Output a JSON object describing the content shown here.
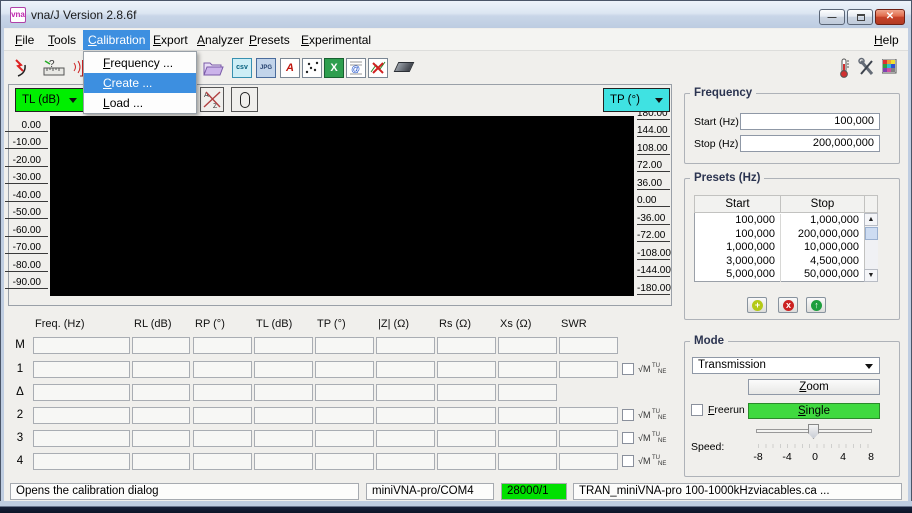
{
  "window": {
    "title": "vna/J Version 2.8.6f",
    "icon": "vna"
  },
  "menu": {
    "items": [
      "File",
      "Tools",
      "Calibration",
      "Export",
      "Analyzer",
      "Presets",
      "Experimental"
    ],
    "help": "Help",
    "active_item": "Calibration",
    "popup": {
      "items": [
        "Frequency ...",
        "Create ...",
        "Load ..."
      ],
      "active": "Create ..."
    }
  },
  "toolbar": {
    "icons": [
      "reconnect-icon",
      "ruler-question-icon",
      "antenna-icon",
      "folder-open-icon",
      "csv-export-icon",
      "jpeg-export-icon",
      "pdf-export-icon",
      "scatter-export-icon",
      "excel-export-icon",
      "report-icon",
      "chart-discard-icon",
      "eraser-icon",
      "temperature-icon",
      "settings-tools-icon",
      "color-palette-icon"
    ],
    "csv_label": "csv",
    "jpg_label": "JPG",
    "excel_label": "X",
    "pdf_label": "A"
  },
  "scale_left": {
    "selected": "TL (dB)",
    "color": "#00ef00",
    "labels": [
      "0.00",
      "-10.00",
      "-20.00",
      "-30.00",
      "-40.00",
      "-50.00",
      "-60.00",
      "-70.00",
      "-80.00",
      "-90.00"
    ]
  },
  "scale_right": {
    "selected": "TP (°)",
    "color": "#3fe2e2",
    "labels": [
      "180.00",
      "144.00",
      "108.00",
      "72.00",
      "36.00",
      "0.00",
      "-36.00",
      "-72.00",
      "-108.00",
      "-144.00",
      "-180.00"
    ]
  },
  "frequency": {
    "title": "Frequency",
    "start_label": "Start (Hz)",
    "start_value": "100,000",
    "stop_label": "Stop (Hz)",
    "stop_value": "200,000,000"
  },
  "presets": {
    "title": "Presets (Hz)",
    "columns": [
      "Start",
      "Stop"
    ],
    "rows": [
      [
        "100,000",
        "1,000,000"
      ],
      [
        "100,000",
        "200,000,000"
      ],
      [
        "1,000,000",
        "10,000,000"
      ],
      [
        "3,000,000",
        "4,500,000"
      ],
      [
        "5,000,000",
        "50,000,000"
      ]
    ],
    "add_glyph": "+",
    "delete_glyph": "x",
    "up_glyph": "↑"
  },
  "mode": {
    "title": "Mode",
    "selected": "Transmission",
    "zoom_label": "Zoom",
    "freerun_label": "Freerun",
    "single_label": "Single",
    "speed_label": "Speed:",
    "ticks": [
      "-8",
      "-4",
      "0",
      "4",
      "8"
    ]
  },
  "markers": {
    "columns": [
      "Freq. (Hz)",
      "RL (dB)",
      "RP (°)",
      "TL (dB)",
      "TP (°)",
      "|Z| (Ω)",
      "Rs (Ω)",
      "Xs (Ω)",
      "SWR"
    ],
    "rows": [
      "M",
      "1",
      "Δ",
      "2",
      "3",
      "4"
    ],
    "tune_radical": "√M",
    "tune_top": "TU",
    "tune_bottom": "NE"
  },
  "statusbar": {
    "message": "Opens the calibration dialog",
    "device": "miniVNA-pro/COM4",
    "samples": "28000/1",
    "samples_color": "#00e000",
    "calibration_file": "TRAN_miniVNA-pro 100-1000kHzviacables.ca ..."
  }
}
